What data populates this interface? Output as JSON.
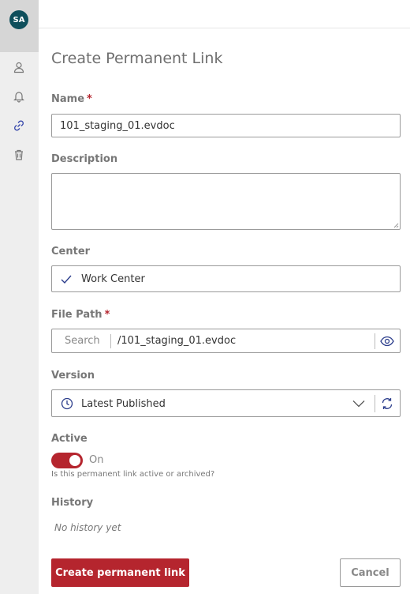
{
  "sidebar": {
    "avatar_initials": "SA",
    "items": [
      {
        "icon": "user-icon"
      },
      {
        "icon": "bell-icon"
      },
      {
        "icon": "link-icon"
      },
      {
        "icon": "trash-icon"
      }
    ]
  },
  "form": {
    "title": "Create Permanent Link",
    "name": {
      "label": "Name",
      "required": "*",
      "value": "101_staging_01.evdoc"
    },
    "description": {
      "label": "Description",
      "value": ""
    },
    "center": {
      "label": "Center",
      "value": "Work Center"
    },
    "file_path": {
      "label": "File Path",
      "required": "*",
      "search_placeholder": "Search",
      "value": "/101_staging_01.evdoc"
    },
    "version": {
      "label": "Version",
      "value": "Latest Published"
    },
    "active": {
      "label": "Active",
      "state": "On",
      "hint": "Is this permanent link active or archived?"
    },
    "history": {
      "label": "History",
      "empty": "No history yet"
    },
    "create_button": "Create permanent link",
    "cancel_button": "Cancel"
  },
  "colors": {
    "accent": "#b5252e",
    "icon_blue": "#2c3e8c",
    "avatar": "#0e4f5c"
  }
}
